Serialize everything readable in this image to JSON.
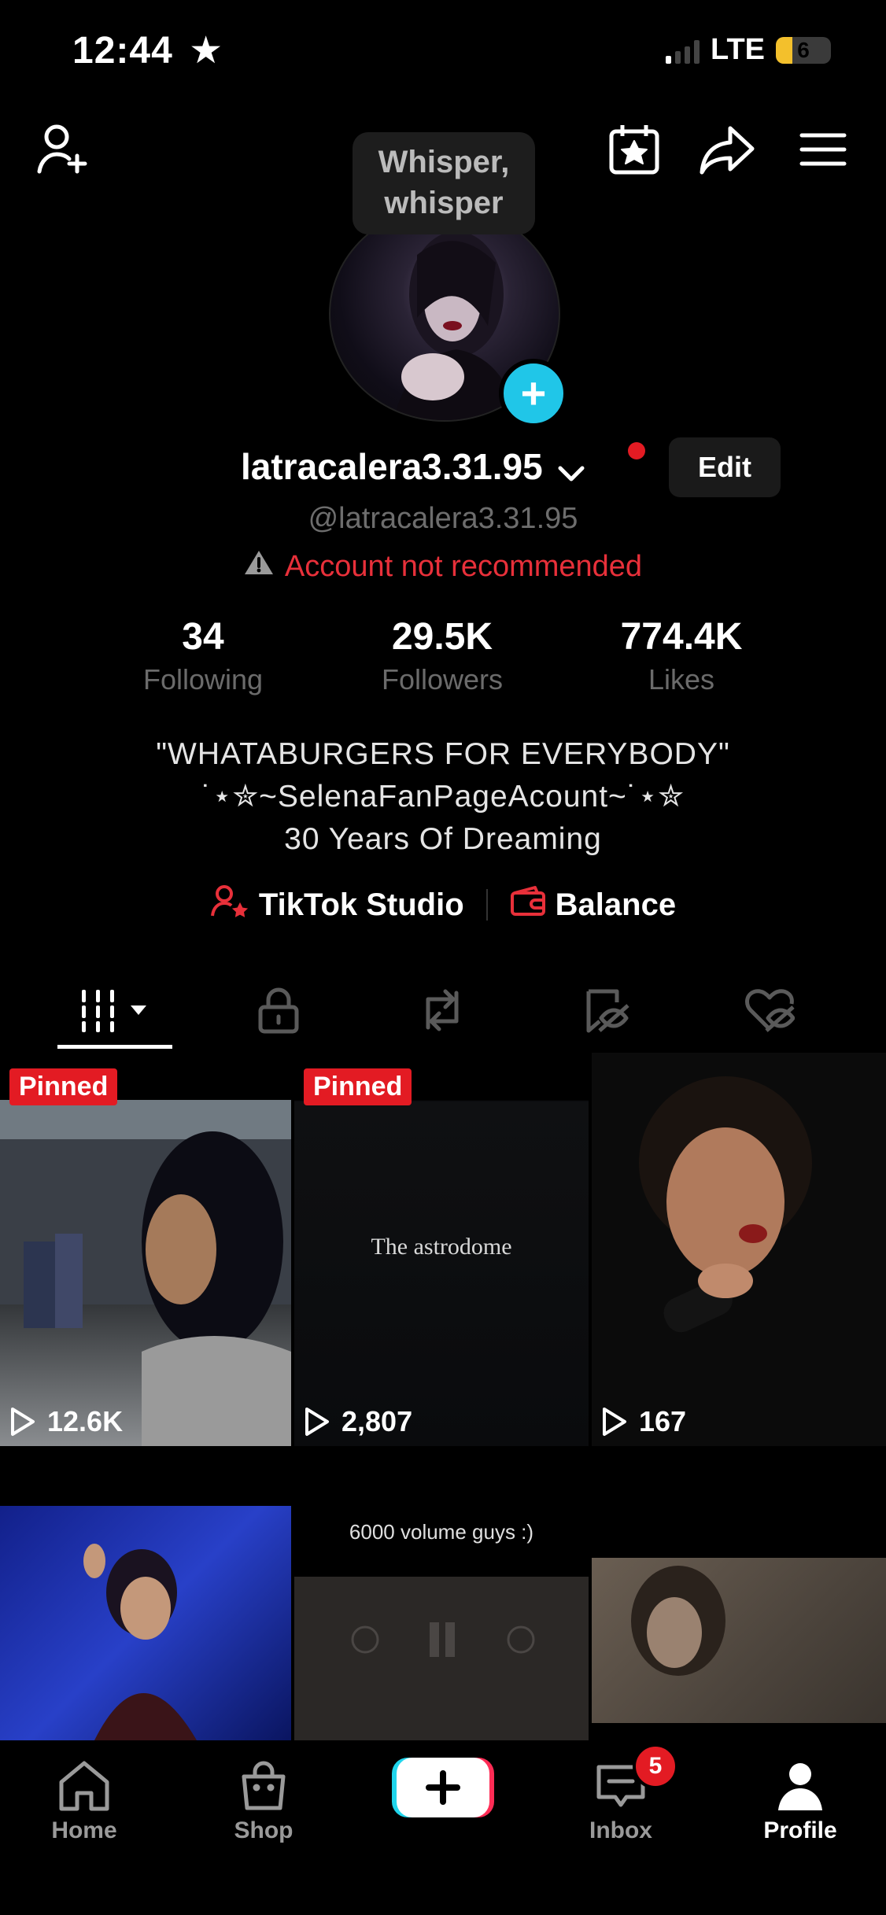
{
  "status_bar": {
    "time": "12:44",
    "carrier": "LTE",
    "battery": "6",
    "battery_level": 0.3
  },
  "tooltip": {
    "line1": "Whisper,",
    "line2": "whisper"
  },
  "profile": {
    "username": "latracalera3.31.95",
    "handle": "@latracalera3.31.95",
    "warning": "Account not recommended",
    "edit_label": "Edit"
  },
  "stats": [
    {
      "value": "34",
      "label": "Following"
    },
    {
      "value": "29.5K",
      "label": "Followers"
    },
    {
      "value": "774.4K",
      "label": "Likes"
    }
  ],
  "bio": {
    "line1": "\"WHATABURGERS FOR EVERYBODY\"",
    "line2": "˙⋆✮~SelenaFanPageAcount~˙⋆✮",
    "line3": "30 Years Of Dreaming"
  },
  "links": {
    "studio": "TikTok Studio",
    "balance": "Balance"
  },
  "videos": [
    {
      "pinned": "Pinned",
      "views": "12.6K"
    },
    {
      "pinned": "Pinned",
      "views": "2,807",
      "overlay": "The astrodome"
    },
    {
      "views": "167"
    },
    {},
    {
      "overlay": "6000 volume guys :)"
    },
    {}
  ],
  "nav": {
    "home": "Home",
    "shop": "Shop",
    "inbox": "Inbox",
    "profile": "Profile",
    "inbox_badge": "5"
  },
  "colors": {
    "accent_red": "#e31b23",
    "plus_cyan": "#20c6e8",
    "warning_red": "#e8303a"
  }
}
